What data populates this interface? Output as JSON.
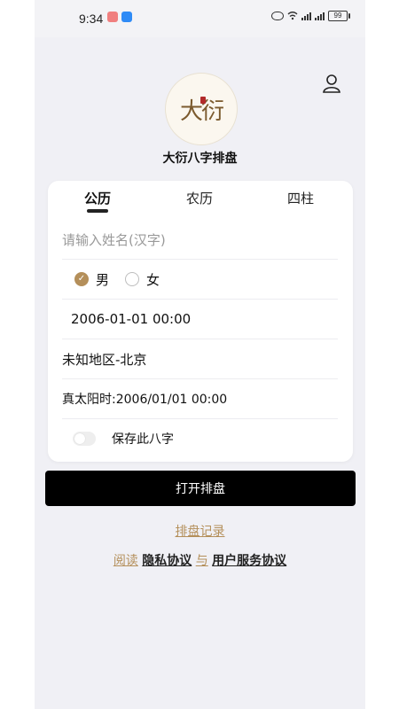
{
  "status_bar": {
    "time": "9:34",
    "battery": "99"
  },
  "header": {
    "app_title": "大衍八字排盘",
    "logo_text": "大衍"
  },
  "tabs": [
    {
      "label": "公历"
    },
    {
      "label": "农历"
    },
    {
      "label": "四柱"
    }
  ],
  "form": {
    "name_placeholder": "请输入姓名(汉字)",
    "gender_male": "男",
    "gender_female": "女",
    "birth_datetime": "2006-01-01 00:00",
    "location": "未知地区-北京",
    "solar_time": "真太阳时:2006/01/01 00:00",
    "save_label": "保存此八字"
  },
  "actions": {
    "open_chart": "打开排盘",
    "records": "排盘记录",
    "read": "阅读",
    "privacy": "隐私协议",
    "and": "与",
    "terms": "用户服务协议"
  },
  "colors": {
    "accent": "#b48f5a",
    "primary_button": "#000000"
  }
}
